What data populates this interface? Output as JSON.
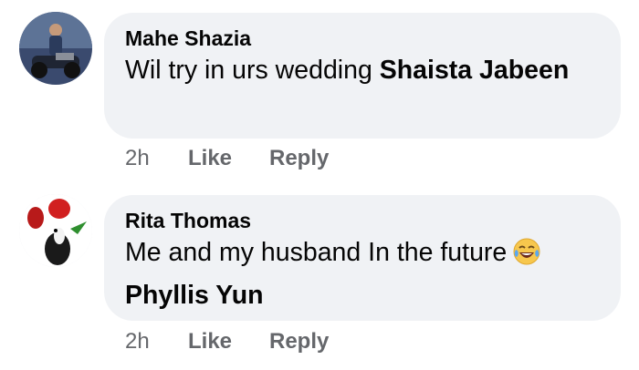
{
  "comments": [
    {
      "author": "Mahe Shazia",
      "text": "Wil try in urs wedding ",
      "mention": "Shaista Jabeen",
      "time": "2h",
      "like_label": "Like",
      "reply_label": "Reply",
      "avatar_icon": "profile-photo-motorbike"
    },
    {
      "author": "Rita Thomas",
      "text": "Me and my husband In the future",
      "emoji_icon": "laughing-tears-emoji",
      "mention": "Phyllis Yun",
      "time": "2h",
      "like_label": "Like",
      "reply_label": "Reply",
      "avatar_icon": "profile-photo-cartoon-bird"
    }
  ],
  "colors": {
    "bubble_bg": "#f0f2f5",
    "text": "#050505",
    "secondary_text": "#65676b"
  }
}
